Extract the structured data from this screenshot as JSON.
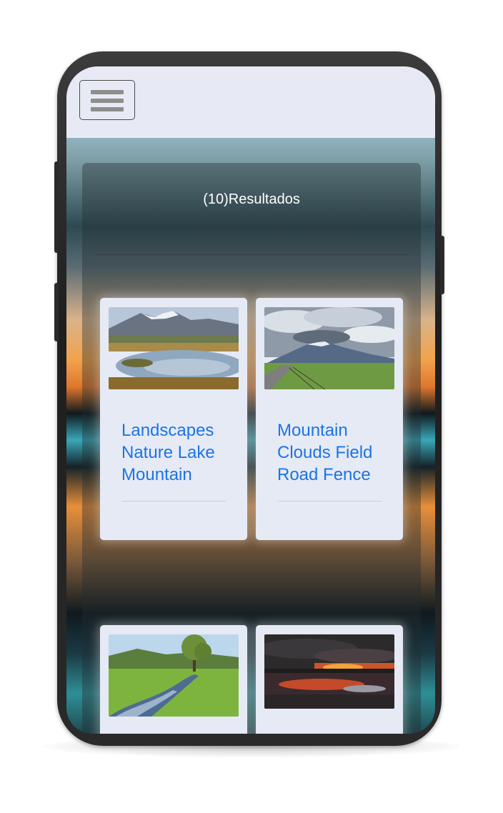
{
  "header": {
    "menu_icon": "hamburger-menu-icon"
  },
  "results": {
    "count_label": "(10)Resultados"
  },
  "cards": [
    {
      "title": "Landscapes Nature Lake Mountain",
      "image": "lake-mountain-photo"
    },
    {
      "title": "Mountain Clouds Field Road Fence",
      "image": "mountain-clouds-field-photo"
    },
    {
      "title": "",
      "image": "green-meadow-creek-photo"
    },
    {
      "title": "",
      "image": "sunset-lake-photo"
    }
  ],
  "colors": {
    "topbar_bg": "#e7eaf4",
    "card_bg": "#e6eaf5",
    "link": "#1b74e6",
    "results_text": "#ffffff"
  }
}
